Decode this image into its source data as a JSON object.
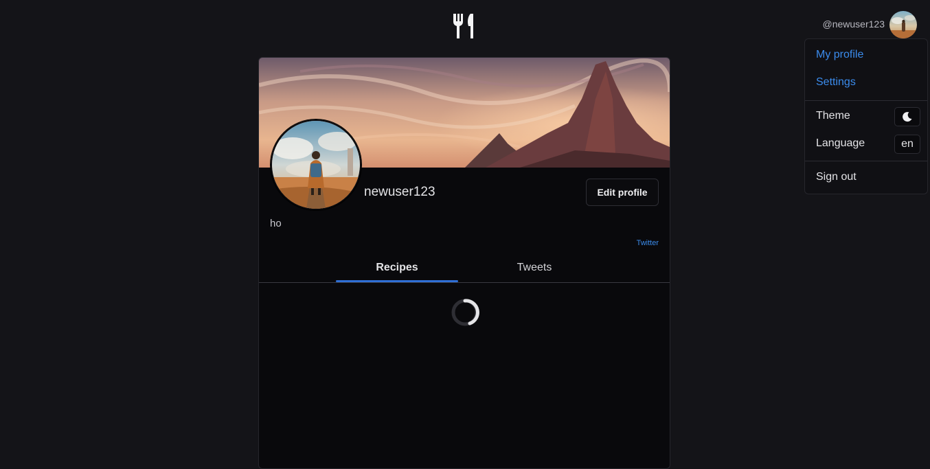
{
  "header": {
    "logo_icon": "fork-knife-icon",
    "handle": "@newuser123"
  },
  "menu": {
    "my_profile": "My profile",
    "settings": "Settings",
    "theme_label": "Theme",
    "theme_icon": "moon-icon",
    "language_label": "Language",
    "language_value": "en",
    "sign_out": "Sign out"
  },
  "profile": {
    "username": "newuser123",
    "edit_button": "Edit profile",
    "bio": "ho",
    "twitter_link": "Twitter"
  },
  "tabs": [
    {
      "label": "Recipes",
      "active": true
    },
    {
      "label": "Tweets",
      "active": false
    }
  ],
  "colors": {
    "accent": "#3b8ced",
    "tab_indicator": "#2f6fd6",
    "background": "#141418",
    "card": "#09090c"
  }
}
